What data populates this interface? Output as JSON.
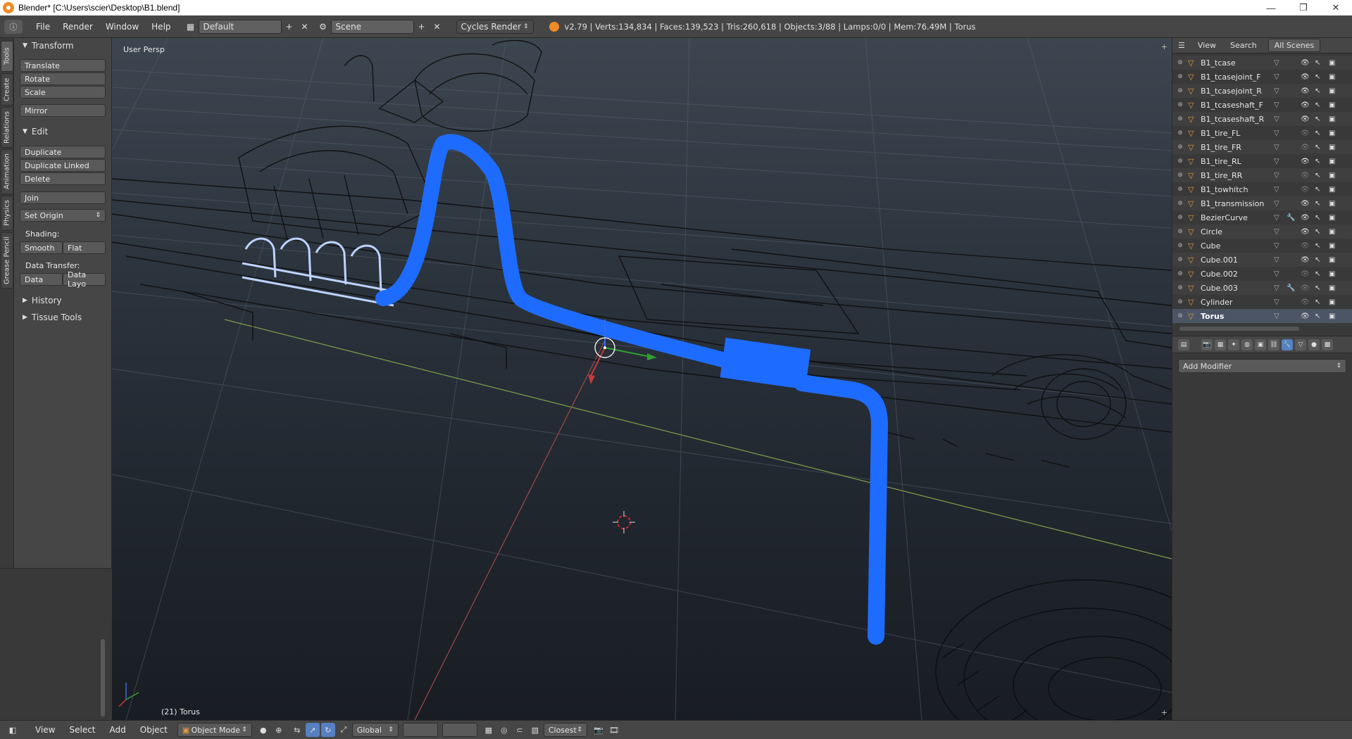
{
  "window": {
    "title": "Blender* [C:\\Users\\scier\\Desktop\\B1.blend]",
    "minimize": "—",
    "restore": "❐",
    "close": "✕"
  },
  "infobar": {
    "menus": [
      "File",
      "Render",
      "Window",
      "Help"
    ],
    "layout": "Default",
    "scene": "Scene",
    "engine": "Cycles Render",
    "stats": "v2.79 | Verts:134,834 | Faces:139,523 | Tris:260,618 | Objects:3/88 | Lamps:0/0 | Mem:76.49M | Torus"
  },
  "tooltabs": [
    "Tools",
    "Create",
    "Relations",
    "Animation",
    "Physics",
    "Grease Pencil"
  ],
  "toolshelf": {
    "transform_title": "Transform",
    "translate": "Translate",
    "rotate": "Rotate",
    "scale": "Scale",
    "mirror": "Mirror",
    "edit_title": "Edit",
    "duplicate": "Duplicate",
    "duplicate_linked": "Duplicate Linked",
    "delete": "Delete",
    "join": "Join",
    "set_origin": "Set Origin",
    "shading_label": "Shading:",
    "smooth": "Smooth",
    "flat": "Flat",
    "data_transfer_label": "Data Transfer:",
    "data": "Data",
    "data_layout": "Data Layo",
    "history": "History",
    "tissue_tools": "Tissue Tools"
  },
  "viewport": {
    "view_name": "User Persp",
    "object_info": "(21) Torus"
  },
  "outliner": {
    "view": "View",
    "search": "Search",
    "scenes": "All Scenes",
    "items": [
      {
        "name": "B1_tcase",
        "visible": true,
        "modifier": false
      },
      {
        "name": "B1_tcasejoint_F",
        "visible": true,
        "modifier": false
      },
      {
        "name": "B1_tcasejoint_R",
        "visible": true,
        "modifier": false
      },
      {
        "name": "B1_tcaseshaft_F",
        "visible": true,
        "modifier": false
      },
      {
        "name": "B1_tcaseshaft_R",
        "visible": true,
        "modifier": false
      },
      {
        "name": "B1_tire_FL",
        "visible": false,
        "modifier": false
      },
      {
        "name": "B1_tire_FR",
        "visible": false,
        "modifier": false
      },
      {
        "name": "B1_tire_RL",
        "visible": true,
        "modifier": false
      },
      {
        "name": "B1_tire_RR",
        "visible": false,
        "modifier": false
      },
      {
        "name": "B1_towhitch",
        "visible": false,
        "modifier": false
      },
      {
        "name": "B1_transmission",
        "visible": true,
        "modifier": false
      },
      {
        "name": "BezierCurve",
        "visible": true,
        "modifier": true
      },
      {
        "name": "Circle",
        "visible": true,
        "modifier": false
      },
      {
        "name": "Cube",
        "visible": false,
        "modifier": false
      },
      {
        "name": "Cube.001",
        "visible": true,
        "modifier": false
      },
      {
        "name": "Cube.002",
        "visible": false,
        "modifier": false
      },
      {
        "name": "Cube.003",
        "visible": false,
        "modifier": true
      },
      {
        "name": "Cylinder",
        "visible": false,
        "modifier": false
      },
      {
        "name": "Torus",
        "visible": true,
        "modifier": false,
        "active": true
      }
    ]
  },
  "properties": {
    "add_modifier": "Add Modifier"
  },
  "bottombar": {
    "menus": [
      "View",
      "Select",
      "Add",
      "Object"
    ],
    "mode": "Object Mode",
    "orientation": "Global",
    "snap": "Closest"
  },
  "colors": {
    "selected_mesh": "#1e6cff",
    "wire": "#0c0c0c",
    "accent": "#5680c2"
  }
}
